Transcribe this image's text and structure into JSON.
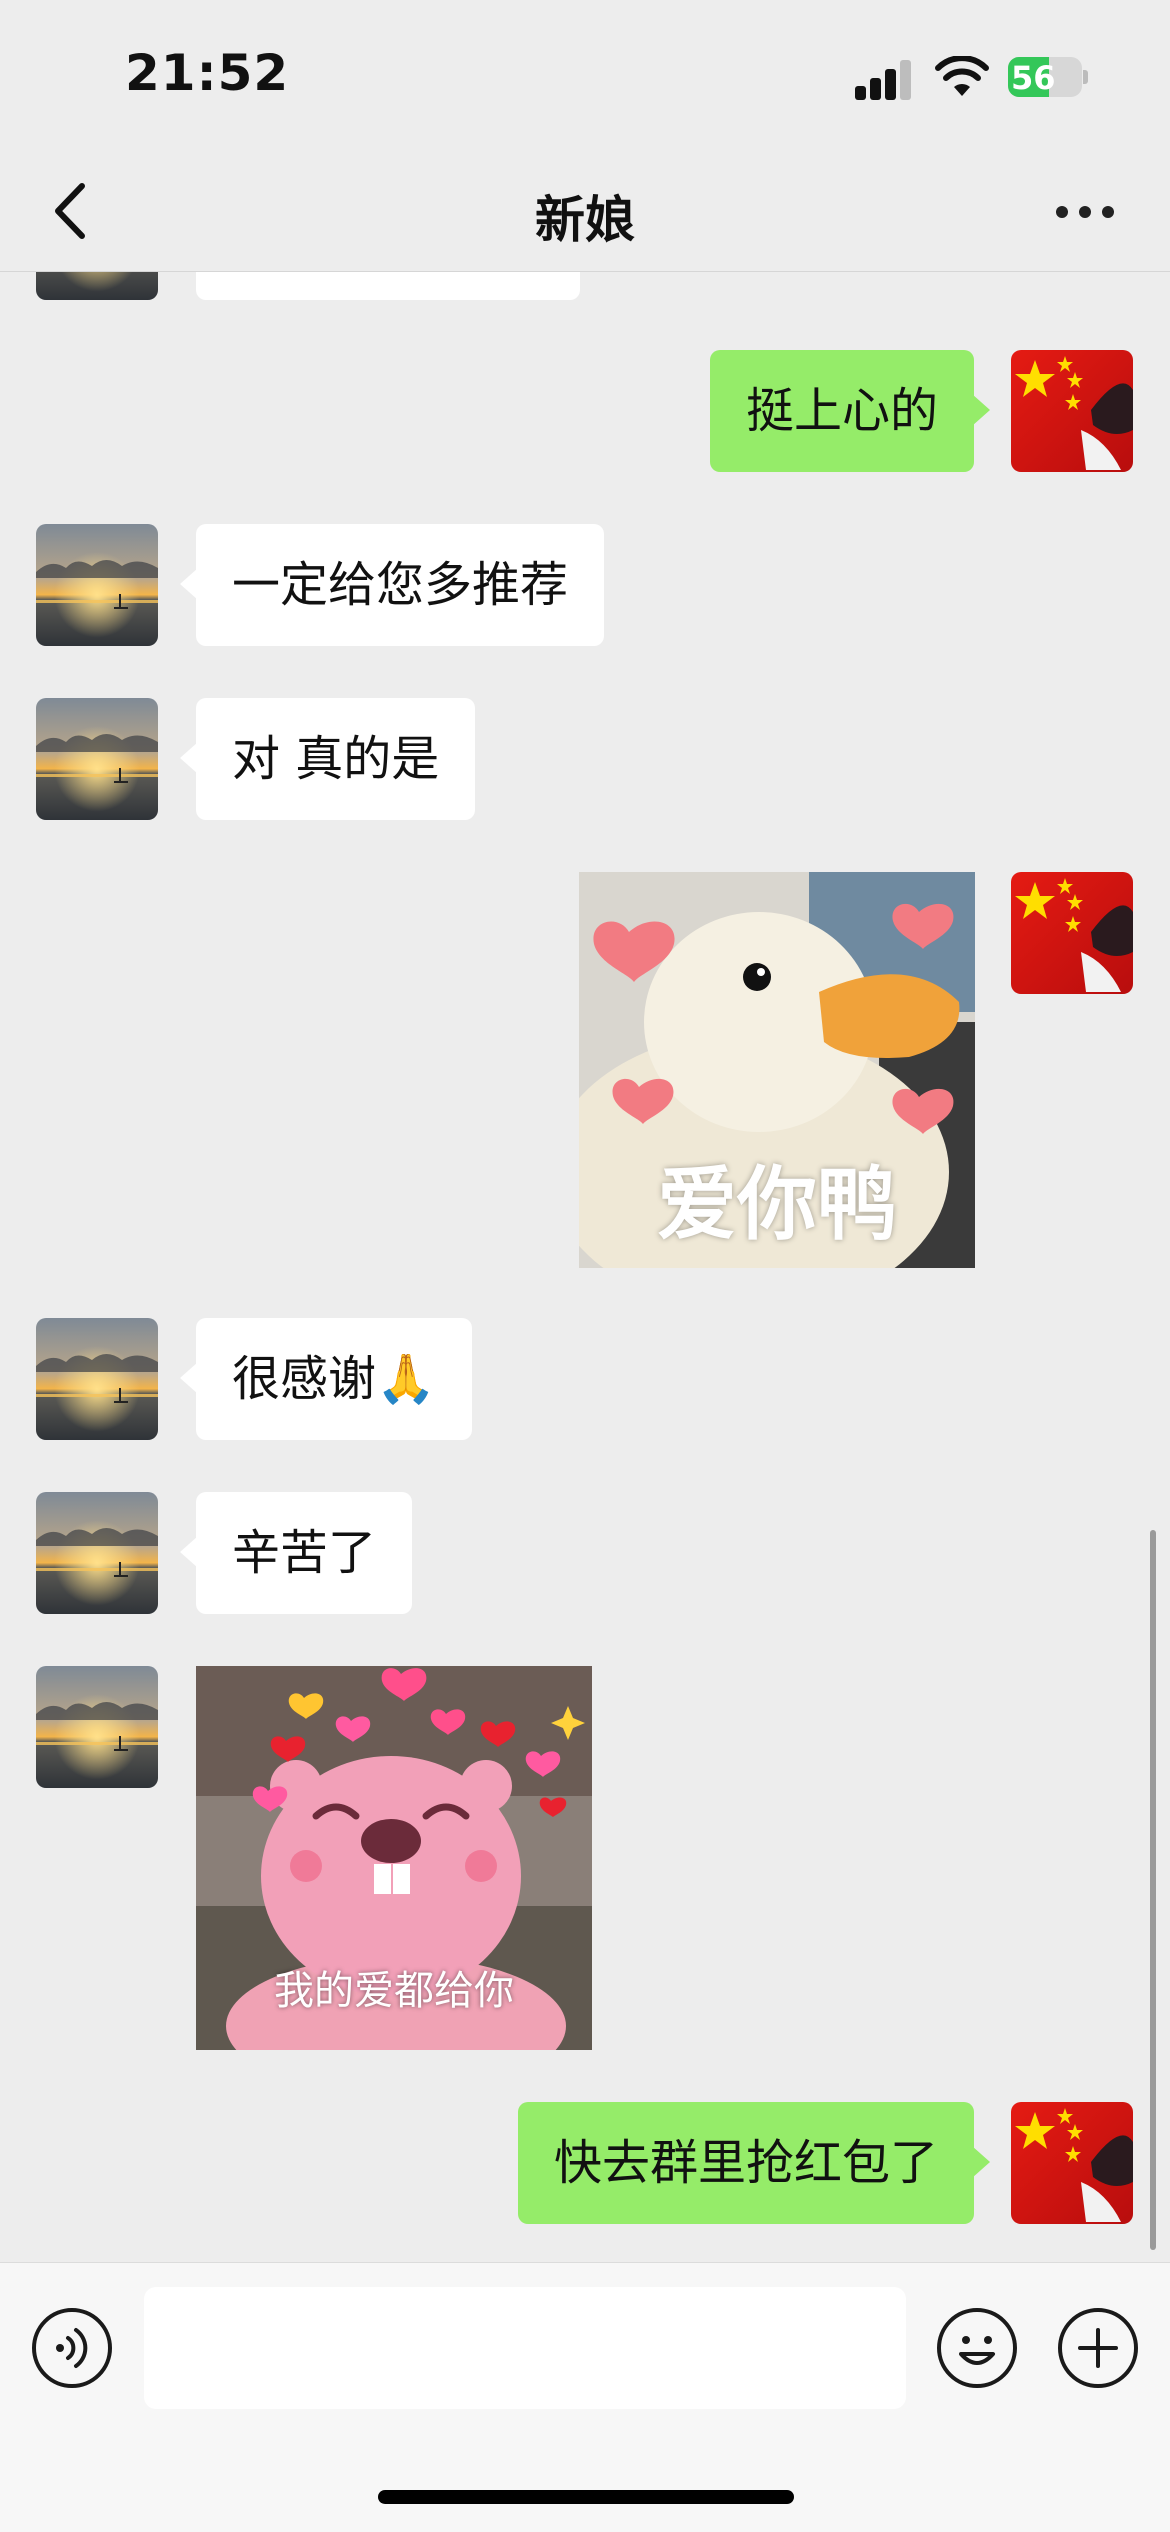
{
  "status_bar": {
    "time": "21:52",
    "battery_level": "56",
    "battery_fraction": 0.56
  },
  "nav": {
    "title": "新娘",
    "back_icon": "chevron-left-icon",
    "more_icon": "more-dots-icon"
  },
  "messages": [
    {
      "side": "right",
      "type": "text",
      "text": "挺上心的"
    },
    {
      "side": "left",
      "type": "text",
      "text": "一定给您多推荐"
    },
    {
      "side": "left",
      "type": "text",
      "text": "对 真的是"
    },
    {
      "side": "right",
      "type": "sticker",
      "caption": "爱你鸭"
    },
    {
      "side": "left",
      "type": "text",
      "text": "很感谢🙏"
    },
    {
      "side": "left",
      "type": "text",
      "text": "辛苦了"
    },
    {
      "side": "left",
      "type": "sticker",
      "caption": "我的爱都给你"
    },
    {
      "side": "right",
      "type": "text",
      "text": "快去群里抢红包了"
    }
  ],
  "input_bar": {
    "voice_icon": "voice-icon",
    "emoji_icon": "emoji-icon",
    "plus_icon": "plus-icon",
    "text_value": ""
  },
  "colors": {
    "background": "#ededed",
    "own_bubble": "#95ec69",
    "other_bubble": "#ffffff",
    "battery": "#34c759"
  }
}
